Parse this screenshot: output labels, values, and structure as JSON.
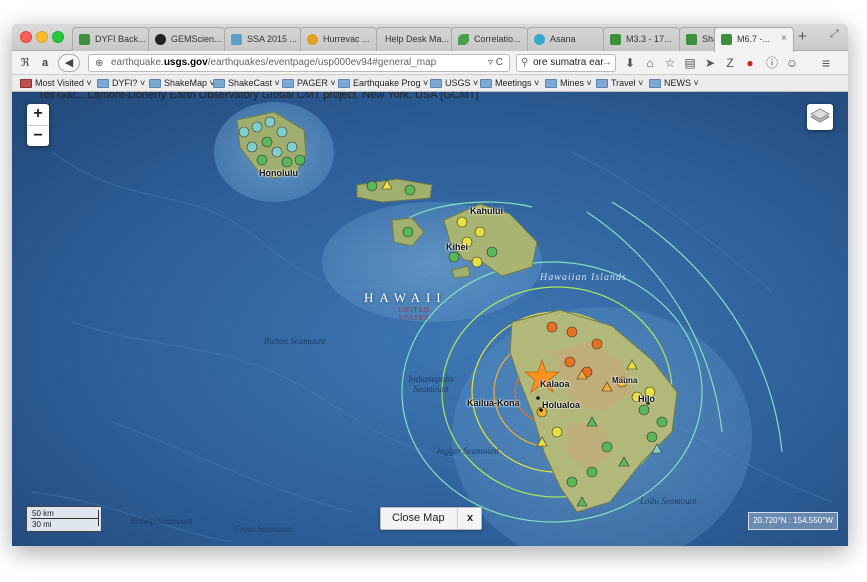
{
  "browser": {
    "tabs": [
      {
        "label": "DYFI Back...",
        "favicon_color": "#3c8f3c"
      },
      {
        "label": "GEMScien...",
        "favicon_color": "#222222"
      },
      {
        "label": "SSA 2015 ...",
        "favicon_color": "#5aa0c8"
      },
      {
        "label": "Hurrevac ...",
        "favicon_color": "#e0a020"
      },
      {
        "label": "Help Desk Ma...",
        "favicon_color": "#cccccc"
      },
      {
        "label": "Correlatio...",
        "favicon_color": "#4aa04a"
      },
      {
        "label": "Asana",
        "favicon_color": "#33aacc"
      },
      {
        "label": "M3.3 - 17...",
        "favicon_color": "#3c8f3c"
      },
      {
        "label": "Shakemap...",
        "favicon_color": "#3c8f3c"
      },
      {
        "label": "M6.7 -...",
        "favicon_color": "#3c8f3c"
      }
    ],
    "active_tab_close": "×",
    "new_tab": "+",
    "url": {
      "prefix": "earthquake.",
      "host": "usgs.gov",
      "path": "/earthquakes/eventpage/usp000ev94#general_map"
    },
    "search_value": "ore sumatra ear",
    "bookmarks": [
      "Most Visited ˅",
      "DYFI? ˅",
      "ShakeMap ˅",
      "ShakeCast ˅",
      "PAGER ˅",
      "Earthquake Prog ˅",
      "USGS ˅",
      "Meetings ˅",
      "Mines ˅",
      "Travel ˅",
      "NEWS ˅"
    ]
  },
  "page": {
    "background_text": "Tell Gar...    Lamont-Doherty Earth Observatory Global CMT project. New York, USA [GCMT]",
    "zoom_in": "+",
    "zoom_out": "−",
    "close_map_label": "Close Map",
    "close_map_x": "x",
    "coordinates": "20.720°N : 154.550°W",
    "scale": {
      "km": "50 km",
      "mi": "30 mi"
    }
  },
  "map": {
    "towns": [
      "Honolulu",
      "Kahului",
      "Kihei",
      "Kailua-Kona",
      "Kalaoa",
      "Holualoa",
      "Hilo",
      "Mauna"
    ],
    "seamounts": [
      "Button Seamount",
      "Indianapolis Seamount",
      "Jagger Seamount",
      "Bishop Seamount",
      "Cross Seamount",
      "Loihi Seamount"
    ],
    "region": "HAWAII",
    "region_sub": "UNITED STATES",
    "channel": "Hawaiian Islands",
    "epicenter_color": "#f7931e",
    "contour_colors": [
      "#80e0c0",
      "#a8e860",
      "#e8e040",
      "#f0b030",
      "#e87020"
    ]
  }
}
